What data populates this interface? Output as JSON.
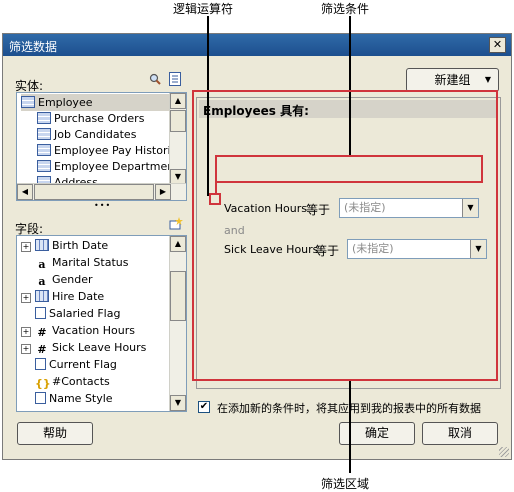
{
  "callouts": {
    "logic_operator": "逻辑运算符",
    "filter_condition": "筛选条件",
    "filter_region": "筛选区域"
  },
  "dialog": {
    "title": "筛选数据",
    "close_glyph": "✕",
    "entity_label": "实体:",
    "new_group_button": "新建组",
    "field_label": "字段:",
    "dots": "•••",
    "help_button": "帮助",
    "ok_button": "确定",
    "cancel_button": "取消",
    "apply_checkbox_label": "在添加新的条件时，将其应用到我的报表中的所有数据",
    "apply_checked": true
  },
  "entities": [
    {
      "label": "Employee",
      "icon": "table-icon",
      "selected": true,
      "indent": 0
    },
    {
      "label": "Purchase Orders",
      "icon": "table-icon",
      "selected": false,
      "indent": 1
    },
    {
      "label": "Job Candidates",
      "icon": "table-icon",
      "selected": false,
      "indent": 1
    },
    {
      "label": "Employee Pay Histories",
      "icon": "table-icon",
      "selected": false,
      "indent": 1
    },
    {
      "label": "Employee Department",
      "icon": "table-icon",
      "selected": false,
      "indent": 1
    },
    {
      "label": "Address",
      "icon": "table-icon",
      "selected": false,
      "indent": 1
    }
  ],
  "fields": [
    {
      "label": "Birth Date",
      "icon": "calendar-icon",
      "expandable": true
    },
    {
      "label": "Marital Status",
      "icon": "text-icon",
      "expandable": false
    },
    {
      "label": "Gender",
      "icon": "text-icon",
      "expandable": false
    },
    {
      "label": "Hire Date",
      "icon": "calendar-icon",
      "expandable": true
    },
    {
      "label": "Salaried Flag",
      "icon": "flag-icon",
      "expandable": false
    },
    {
      "label": "Vacation Hours",
      "icon": "number-icon",
      "expandable": true
    },
    {
      "label": "Sick Leave Hours",
      "icon": "number-icon",
      "expandable": true
    },
    {
      "label": "Current Flag",
      "icon": "flag-icon",
      "expandable": false
    },
    {
      "label": "#Contacts",
      "icon": "aggregate-icon",
      "expandable": false
    },
    {
      "label": "Name Style",
      "icon": "flag-icon",
      "expandable": false
    }
  ],
  "filter": {
    "header": "Employees 具有:",
    "operator": "and",
    "conditions": [
      {
        "field": "Vacation Hours",
        "op": "等于",
        "value": "(未指定)"
      },
      {
        "field": "Sick Leave Hours",
        "op": "等于",
        "value": "(未指定)"
      }
    ]
  },
  "colors": {
    "annotation_red": "#d0343c",
    "title_bar": "#1d4f8e",
    "selected_row": "#d6d3c9"
  }
}
